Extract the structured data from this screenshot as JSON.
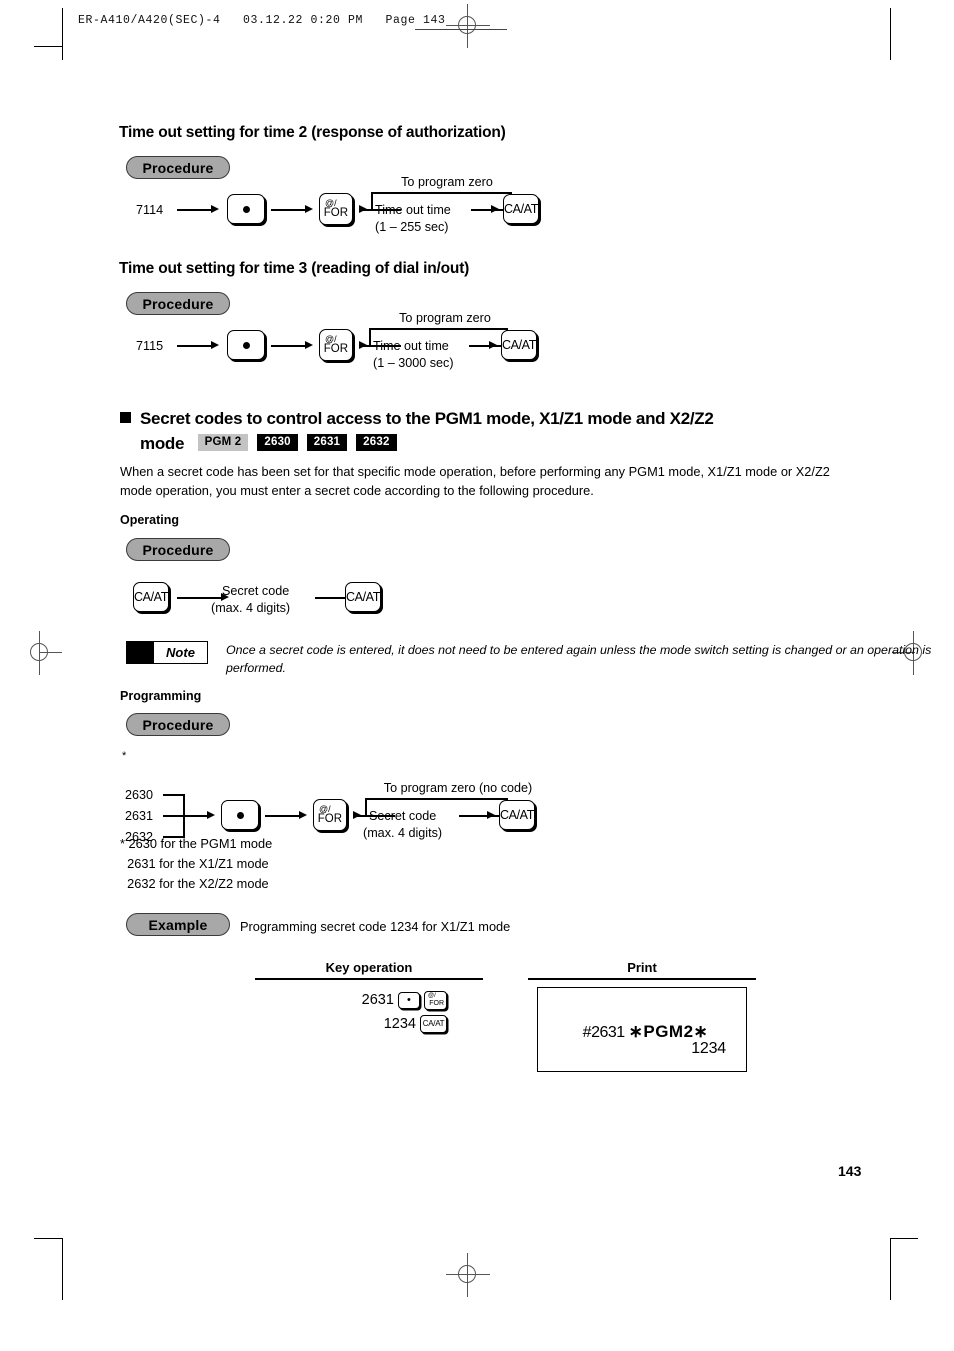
{
  "running_head": "ER-A410/A420(SEC)-4   03.12.22 0:20 PM   Page 143",
  "page_number": "143",
  "labels": {
    "procedure": "Procedure",
    "example": "Example",
    "note": "Note"
  },
  "section_time2": {
    "heading": "Time out setting for time 2 (response of authorization)",
    "code": "7114",
    "branch_label": "To program zero",
    "step_label": "Time out time",
    "step_range": "(1 – 255 sec)",
    "key_dot": "•",
    "key_for_top": "@/",
    "key_for_bottom": "FOR",
    "key_caat": "CA/AT"
  },
  "section_time3": {
    "heading": "Time out setting for time 3 (reading of dial in/out)",
    "code": "7115",
    "branch_label": "To program zero",
    "step_label": "Time out time",
    "step_range": "(1 – 3000 sec)",
    "key_dot": "•",
    "key_for_top": "@/",
    "key_for_bottom": "FOR",
    "key_caat": "CA/AT"
  },
  "secret_section": {
    "heading_line1": "Secret codes to control access to the PGM1 mode, X1/Z1 mode and X2/Z2",
    "heading_line2": "mode",
    "badges": [
      {
        "text": "PGM 2",
        "style": "grey"
      },
      {
        "text": "2630",
        "style": "black"
      },
      {
        "text": "2631",
        "style": "black"
      },
      {
        "text": "2632",
        "style": "black"
      }
    ],
    "intro": "When a secret code has been set for that specific mode operation, before performing any PGM1 mode, X1/Z1 mode or X2/Z2 mode operation, you must enter a secret code according to the following procedure.",
    "operating_heading": "Operating",
    "operating": {
      "key_caat_start": "CA/AT",
      "step_label": "Secret code",
      "step_sub": "(max. 4 digits)",
      "key_caat_end": "CA/AT"
    },
    "note_text": "Once a secret code is entered, it does not need to be entered again unless the mode switch setting is changed or an operation is performed.",
    "programming_heading": "Programming",
    "programming": {
      "asterisk": "*",
      "codes": [
        "2630",
        "2631",
        "2632"
      ],
      "key_dot": "•",
      "key_for_top": "@/",
      "key_for_bottom": "FOR",
      "branch_label": "To program zero (no code)",
      "step_label": "Secret code",
      "step_sub": "(max. 4 digits)",
      "key_caat": "CA/AT"
    },
    "footnote": "* 2630 for the PGM1 mode\n  2631 for the X1/Z1 mode\n  2632 for the X2/Z2 mode",
    "example_text": "Programming secret code 1234 for X1/Z1 mode"
  },
  "example_table": {
    "col_key_operation": "Key operation",
    "col_print": "Print",
    "key_rows": [
      {
        "digits": "2631",
        "keys": [
          "dot",
          "for"
        ]
      },
      {
        "digits": "1234",
        "keys": [
          "caat"
        ]
      }
    ],
    "key_glyphs": {
      "dot": "•",
      "for_top": "@/",
      "for_bottom": "FOR",
      "caat": "CA/AT"
    },
    "print_receipt": {
      "line1_a": "#2631 ",
      "line1_b": "∗PGM2∗",
      "line2": "1234"
    }
  }
}
